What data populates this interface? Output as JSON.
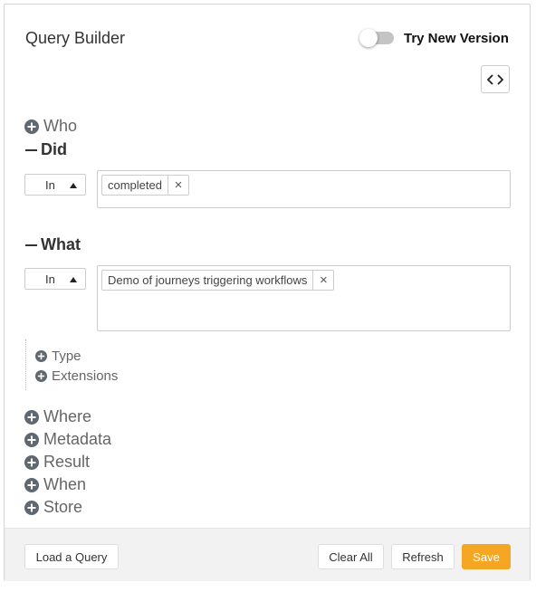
{
  "header": {
    "title": "Query Builder",
    "toggle_label": "Try New Version"
  },
  "sections": {
    "who": "Who",
    "did": "Did",
    "what": "What",
    "where": "Where",
    "metadata": "Metadata",
    "result": "Result",
    "when": "When",
    "store": "Store"
  },
  "did": {
    "operator": "In",
    "tags": [
      "completed"
    ]
  },
  "what": {
    "operator": "In",
    "tags": [
      "Demo of journeys triggering workflows"
    ],
    "subsections": {
      "type": "Type",
      "extensions": "Extensions"
    }
  },
  "footer": {
    "load": "Load a Query",
    "clear": "Clear All",
    "refresh": "Refresh",
    "save": "Save"
  },
  "colors": {
    "accent": "#f5a623",
    "icon": "#5f6770",
    "toggle_track": "#c4c4c4"
  }
}
